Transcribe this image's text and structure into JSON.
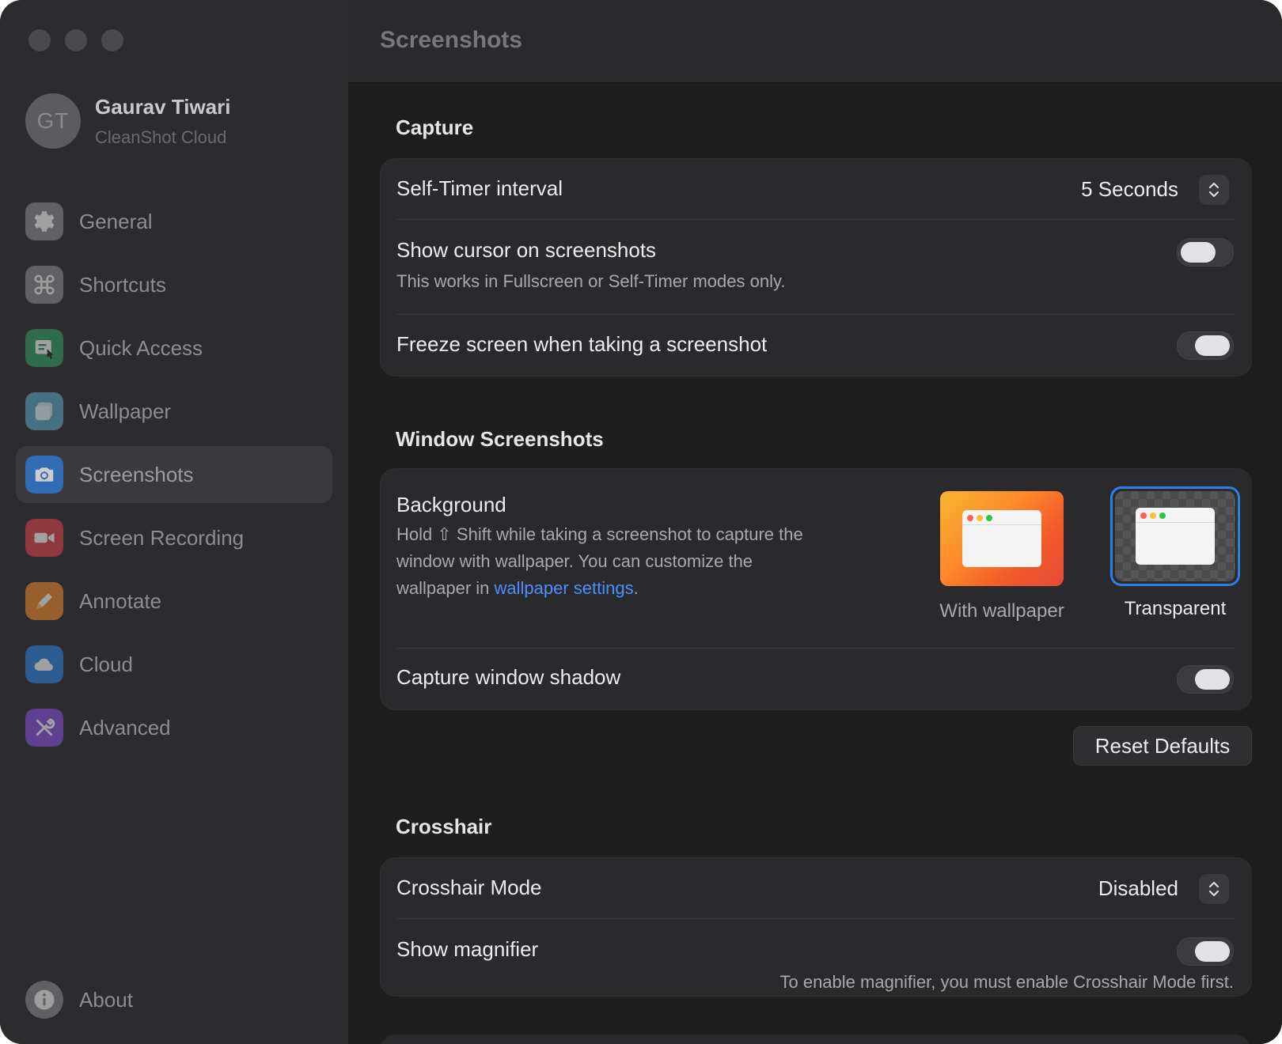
{
  "window": {
    "title": "Screenshots"
  },
  "profile": {
    "initials": "GT",
    "name": "Gaurav Tiwari",
    "subtitle": "CleanShot Cloud"
  },
  "sidebar": {
    "items": [
      {
        "label": "General",
        "icon": "gear-icon",
        "color": "#8e8e93"
      },
      {
        "label": "Shortcuts",
        "icon": "command-icon",
        "color": "#8e8e93"
      },
      {
        "label": "Quick Access",
        "icon": "quick-access-icon",
        "color": "#34a06a"
      },
      {
        "label": "Wallpaper",
        "icon": "wallpaper-icon",
        "color": "#5aa9c8"
      },
      {
        "label": "Screenshots",
        "icon": "camera-icon",
        "color": "#2f7fe0"
      },
      {
        "label": "Screen Recording",
        "icon": "video-icon",
        "color": "#e0424f"
      },
      {
        "label": "Annotate",
        "icon": "pencil-icon",
        "color": "#f08a2a"
      },
      {
        "label": "Cloud",
        "icon": "cloud-icon",
        "color": "#2f86e0"
      },
      {
        "label": "Advanced",
        "icon": "tools-icon",
        "color": "#8a4fe0"
      }
    ],
    "active": "Screenshots",
    "about": {
      "label": "About",
      "icon": "info-icon"
    }
  },
  "capture": {
    "title": "Capture",
    "self_timer": {
      "label": "Self-Timer interval",
      "value": "5 Seconds"
    },
    "show_cursor": {
      "label": "Show cursor on screenshots",
      "sub": "This works in Fullscreen or Self-Timer modes only.",
      "enabled": false
    },
    "freeze": {
      "label": "Freeze screen when taking a screenshot",
      "enabled": true
    }
  },
  "window_screenshots": {
    "title": "Window Screenshots",
    "background": {
      "label": "Background",
      "sub_line1": "Hold ⇧ Shift while taking a screenshot to capture the",
      "sub_line2": "window with wallpaper. You can customize the",
      "sub_line3_prefix": "wallpaper in ",
      "sub_link": "wallpaper settings",
      "sub_line3_suffix": ".",
      "options": [
        {
          "label": "With wallpaper",
          "selected": false
        },
        {
          "label": "Transparent",
          "selected": true
        }
      ]
    },
    "shadow": {
      "label": "Capture window shadow",
      "enabled": true
    },
    "reset_label": "Reset Defaults"
  },
  "crosshair": {
    "title": "Crosshair",
    "mode": {
      "label": "Crosshair Mode",
      "value": "Disabled"
    },
    "magnifier": {
      "label": "Show magnifier",
      "enabled": true,
      "note": "To enable magnifier, you must enable Crosshair Mode first."
    }
  },
  "colors": {
    "accent": "#2f7fe0",
    "link": "#4a90ff"
  }
}
